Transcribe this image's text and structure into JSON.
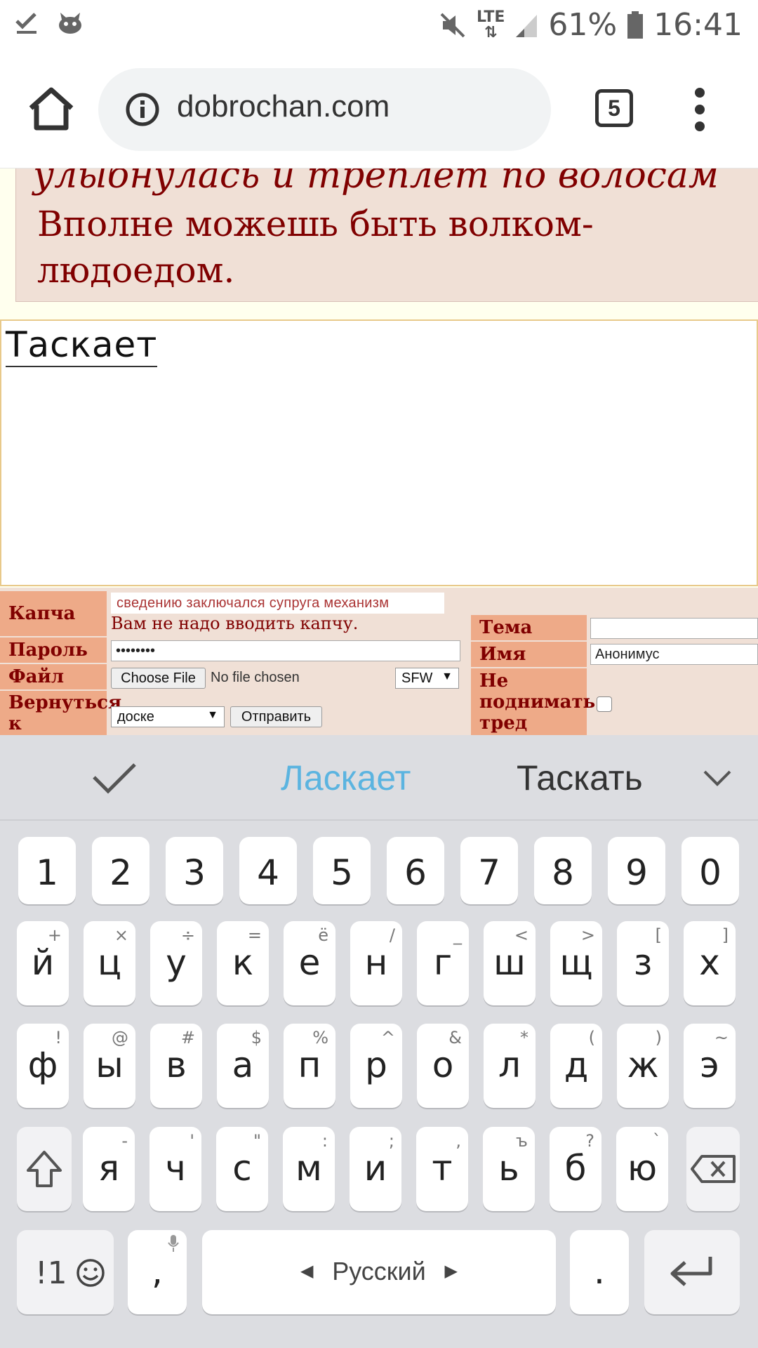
{
  "status_bar": {
    "lte": "LTE",
    "battery": "61%",
    "time": "16:41"
  },
  "browser": {
    "url": "dobrochan.com",
    "tab_count": "5"
  },
  "post": {
    "italic_line": "улыбнулась и треплет по волосам",
    "text": "Вполне можешь быть волком-людоедом."
  },
  "reply": {
    "message": "Таскает"
  },
  "form": {
    "captcha_label": "Капча",
    "captcha_words": "сведению заключался супруга механизм",
    "captcha_note": "Вам не надо вводить капчу.",
    "password_label": "Пароль",
    "password_value": "••••••••",
    "file_label": "Файл",
    "choose_file": "Choose File",
    "no_file": "No file chosen",
    "rating_value": "SFW",
    "return_label": "Вернуться к",
    "return_value": "доске",
    "submit": "Отправить",
    "subject_label": "Тема",
    "subject_value": "",
    "name_label": "Имя",
    "name_value": "Анонимус",
    "sage_label": "Не поднимать тред"
  },
  "keyboard": {
    "suggestions": [
      "Ласкает",
      "Таскать"
    ],
    "accent_color": "#5bb4e0",
    "numbers": [
      "1",
      "2",
      "3",
      "4",
      "5",
      "6",
      "7",
      "8",
      "9",
      "0"
    ],
    "row1": [
      {
        "k": "й",
        "s": "+"
      },
      {
        "k": "ц",
        "s": "×"
      },
      {
        "k": "у",
        "s": "÷"
      },
      {
        "k": "к",
        "s": "="
      },
      {
        "k": "е",
        "s": "ё"
      },
      {
        "k": "н",
        "s": "/"
      },
      {
        "k": "г",
        "s": "_"
      },
      {
        "k": "ш",
        "s": "<"
      },
      {
        "k": "щ",
        "s": ">"
      },
      {
        "k": "з",
        "s": "["
      },
      {
        "k": "х",
        "s": "]"
      }
    ],
    "row2": [
      {
        "k": "ф",
        "s": "!"
      },
      {
        "k": "ы",
        "s": "@"
      },
      {
        "k": "в",
        "s": "#"
      },
      {
        "k": "а",
        "s": "$"
      },
      {
        "k": "п",
        "s": "%"
      },
      {
        "k": "р",
        "s": "^"
      },
      {
        "k": "о",
        "s": "&"
      },
      {
        "k": "л",
        "s": "*"
      },
      {
        "k": "д",
        "s": "("
      },
      {
        "k": "ж",
        "s": ")"
      },
      {
        "k": "э",
        "s": "~"
      }
    ],
    "row3": [
      {
        "k": "я",
        "s": "-"
      },
      {
        "k": "ч",
        "s": "'"
      },
      {
        "k": "с",
        "s": "\""
      },
      {
        "k": "м",
        "s": ":"
      },
      {
        "k": "и",
        "s": ";"
      },
      {
        "k": "т",
        "s": ","
      },
      {
        "k": "ь",
        "s": "ъ"
      },
      {
        "k": "б",
        "s": "?"
      },
      {
        "k": "ю",
        "s": "`"
      }
    ],
    "sym_label": "!1",
    "comma": ",",
    "space_label": "Русский",
    "period": "."
  }
}
